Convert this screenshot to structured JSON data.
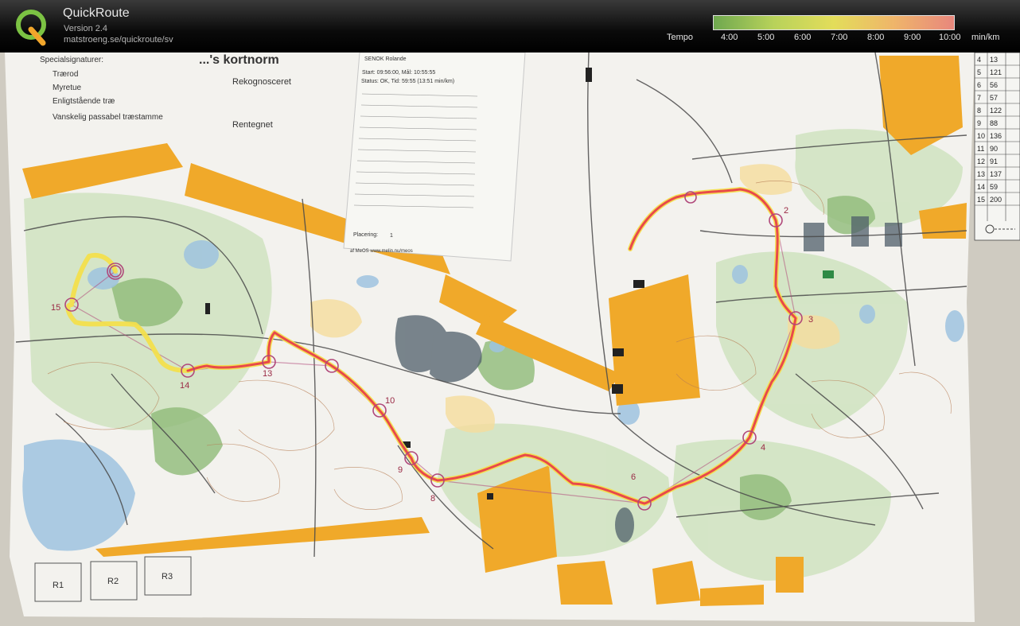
{
  "app": {
    "title": "QuickRoute",
    "version": "Version 2.4",
    "url": "matstroeng.se/quickroute/sv"
  },
  "legend": {
    "label": "Tempo",
    "unit": "min/km",
    "ticks": [
      "4:00",
      "5:00",
      "6:00",
      "7:00",
      "8:00",
      "9:00",
      "10:00"
    ],
    "colors": [
      "#6fa84f",
      "#b8d25a",
      "#e3dd5a",
      "#efb56a",
      "#e8877d"
    ]
  },
  "map": {
    "title": "...'s kortnorm",
    "special_symbols_title": "Specialsignaturer:",
    "special_symbols": [
      "Trærod",
      "Myretue",
      "Enligtstående træ",
      "Vanskelig passabel træstamme"
    ],
    "rekognosceret_title": "Rekognosceret",
    "rentegnet_title": "Rentegnet",
    "results_header": "SENOK Rolande",
    "results_start": "Start: 09:56:00, Mål: 10:55:55",
    "results_status": "Status: OK, Tid: 59:55 (13:51 min/km)",
    "placering": "Placering:",
    "placering_value": "1",
    "results_footer": "af MeOS  www.melin.nu/meos",
    "control_numbers": [
      "2",
      "3",
      "4",
      "6",
      "8",
      "9",
      "10",
      "13",
      "14",
      "15"
    ],
    "description_table": [
      [
        "4",
        "13"
      ],
      [
        "5",
        "121"
      ],
      [
        "6",
        "56"
      ],
      [
        "7",
        "57"
      ],
      [
        "8",
        "122"
      ],
      [
        "9",
        "88"
      ],
      [
        "10",
        "136"
      ],
      [
        "11",
        "90"
      ],
      [
        "12",
        "91"
      ],
      [
        "13",
        "137"
      ],
      [
        "14",
        "59"
      ],
      [
        "15",
        "200"
      ]
    ],
    "relay_boxes": [
      "R1",
      "R2",
      "R3"
    ]
  }
}
